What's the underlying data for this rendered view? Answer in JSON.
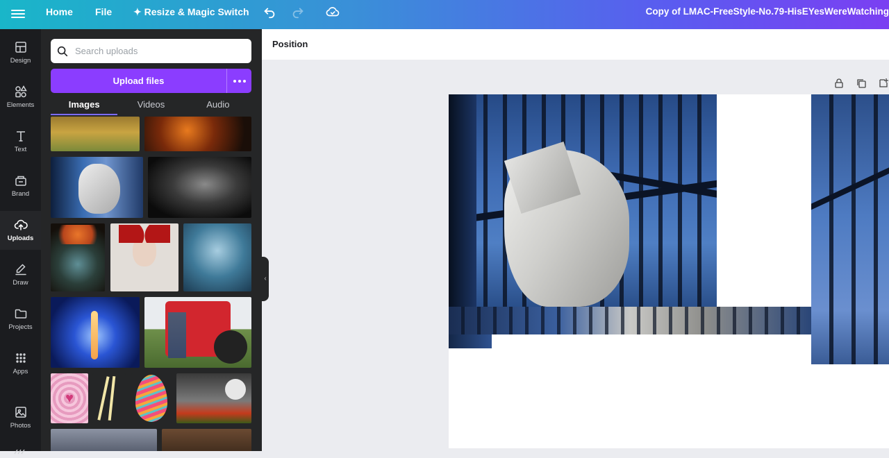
{
  "topbar": {
    "home": "Home",
    "file": "File",
    "resize": "Resize & Magic Switch",
    "title": "Copy of LMAC-FreeStyle-No.79-HisEYesWereWatching"
  },
  "rail": {
    "items": [
      {
        "label": "Design",
        "icon": "design-icon"
      },
      {
        "label": "Elements",
        "icon": "elements-icon"
      },
      {
        "label": "Text",
        "icon": "text-icon"
      },
      {
        "label": "Brand",
        "icon": "brand-icon"
      },
      {
        "label": "Uploads",
        "icon": "upload-cloud-icon"
      },
      {
        "label": "Draw",
        "icon": "draw-icon"
      },
      {
        "label": "Projects",
        "icon": "folder-icon"
      },
      {
        "label": "Apps",
        "icon": "apps-icon"
      },
      {
        "label": "Photos",
        "icon": "photos-icon"
      }
    ]
  },
  "panel": {
    "search_placeholder": "Search uploads",
    "upload_label": "Upload files",
    "tabs": [
      "Images",
      "Videos",
      "Audio"
    ]
  },
  "toolbar": {
    "position_label": "Position"
  },
  "colors": {
    "accent": "#8b3dff",
    "rail_bg": "#1b1c1f",
    "panel_bg": "#252627",
    "canvas_bg": "#ebecf0"
  }
}
